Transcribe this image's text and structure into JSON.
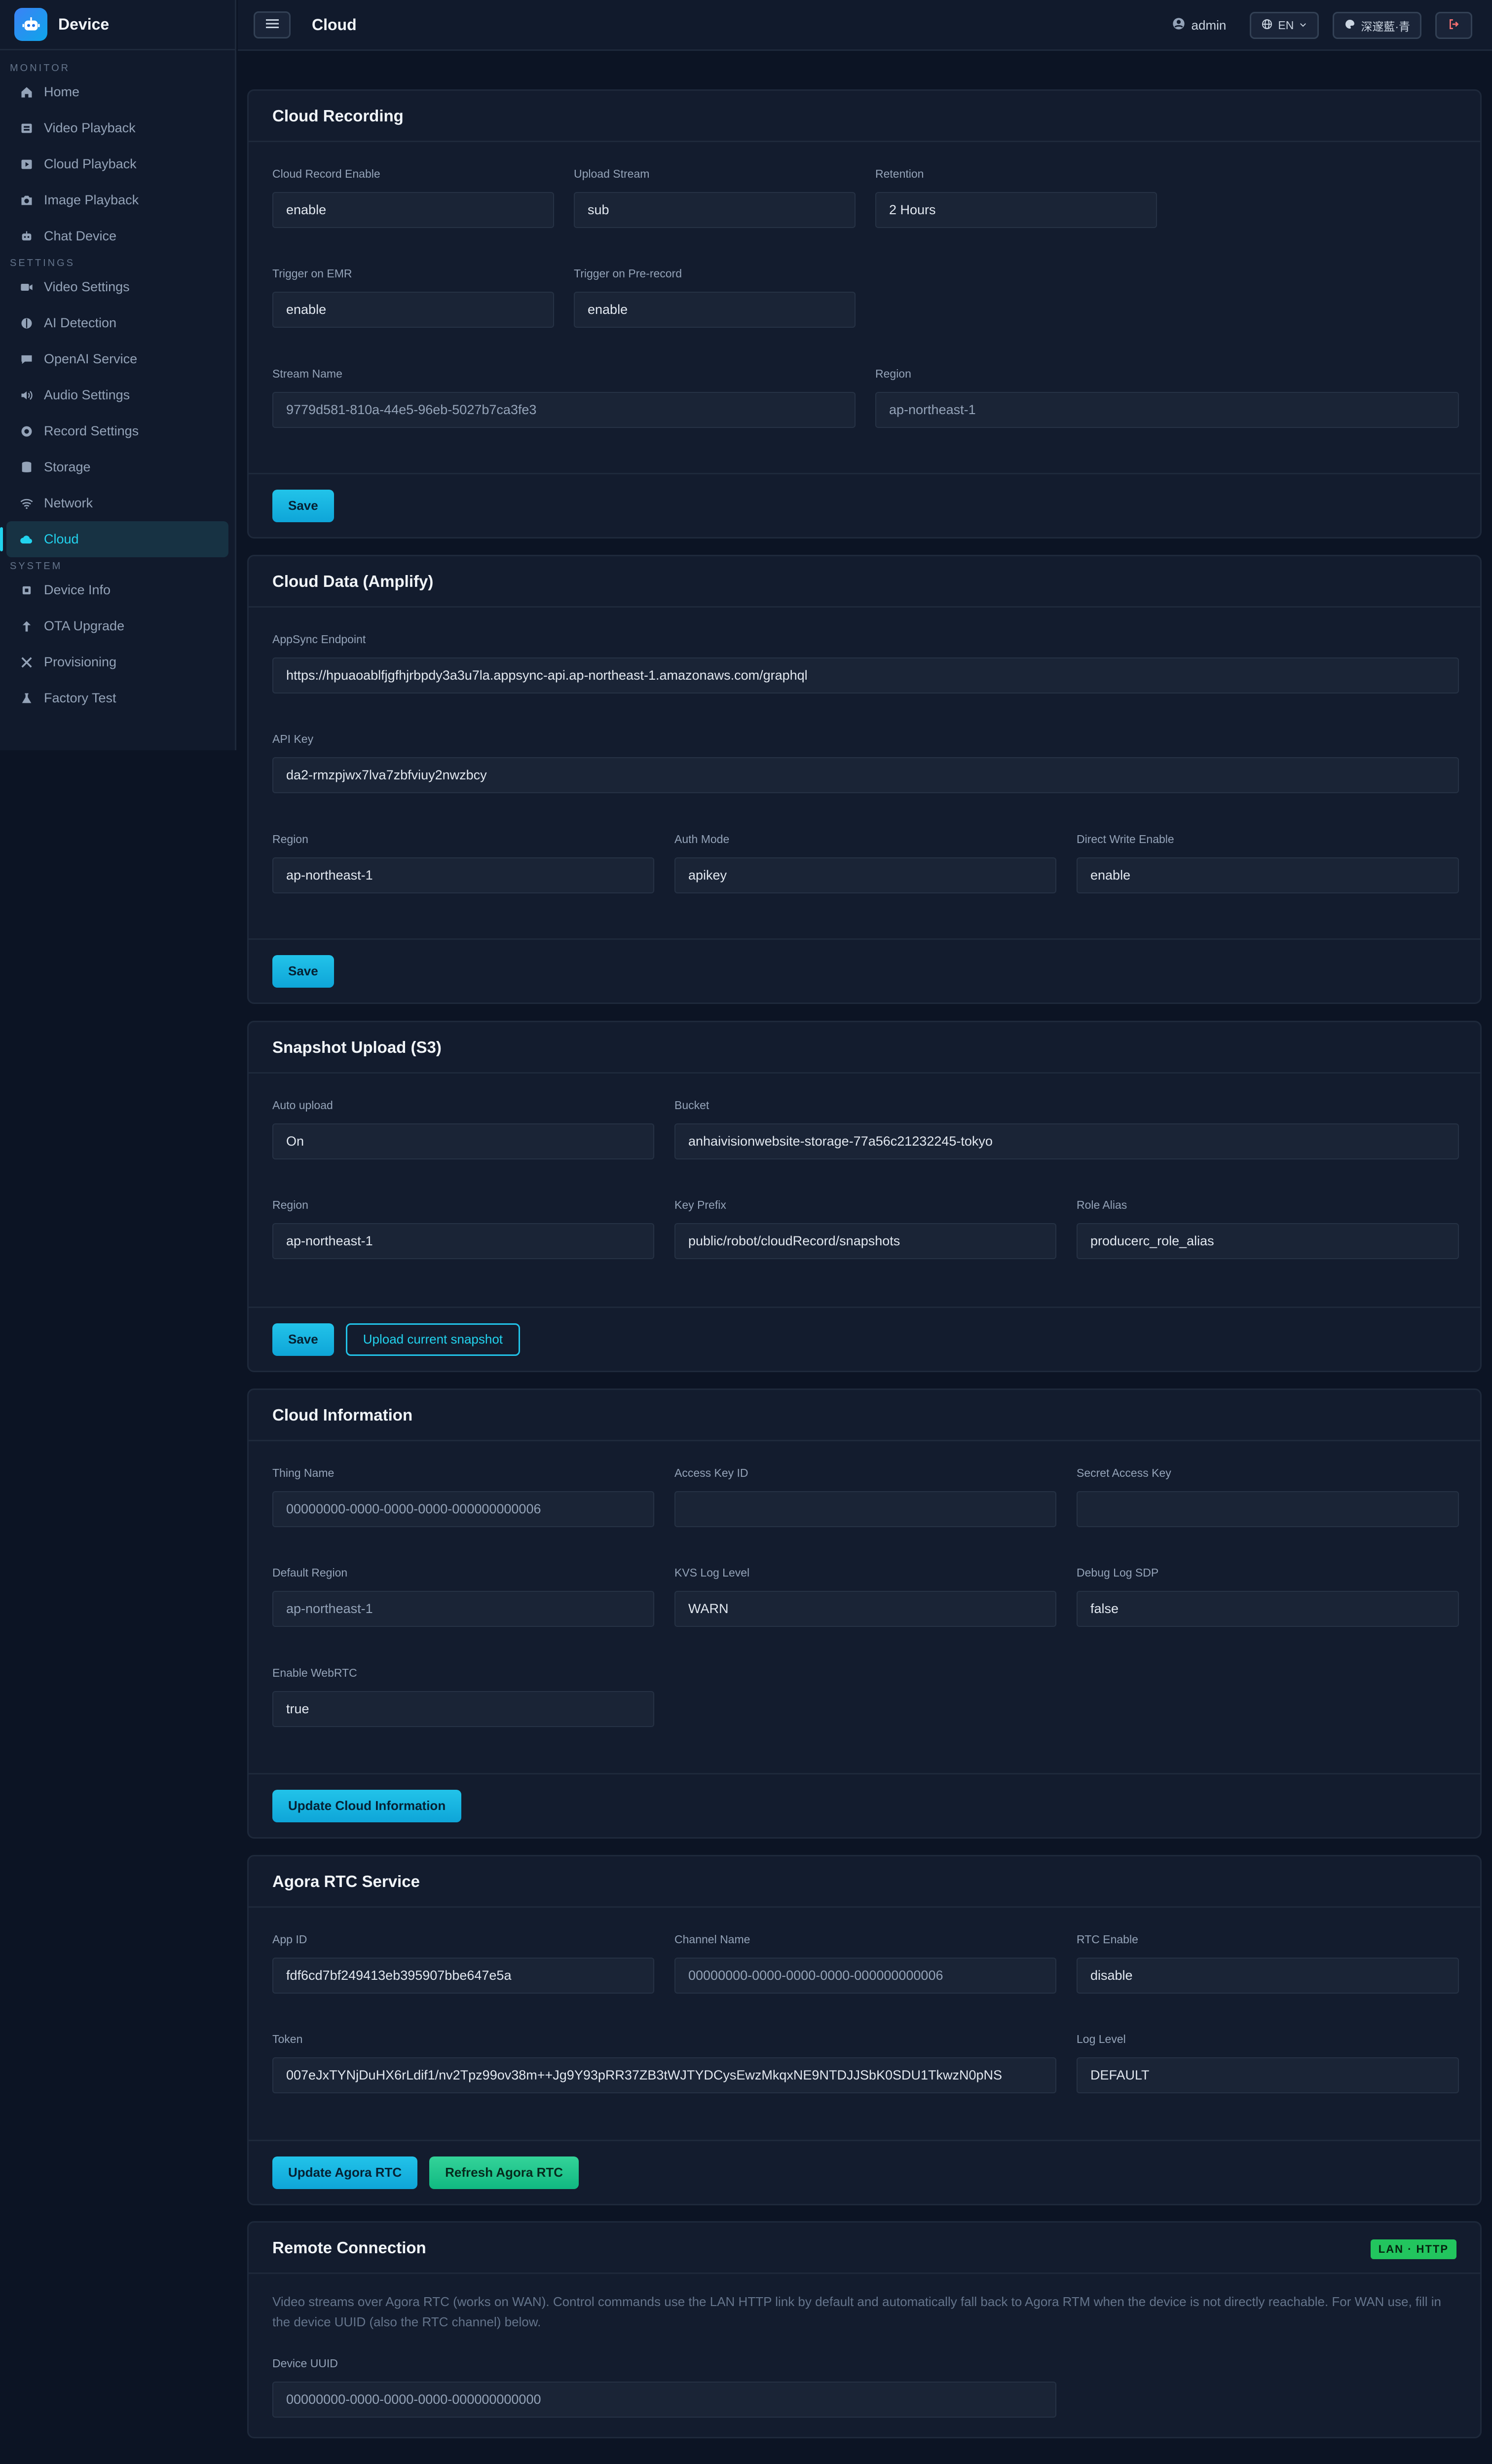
{
  "brand": {
    "title": "Device",
    "icon": "robot-icon"
  },
  "header": {
    "title": "Cloud",
    "user": "admin",
    "language": "EN",
    "theme": "深邃藍·青"
  },
  "sidebar": {
    "sections": {
      "monitor": "MONITOR",
      "settings": "SETTINGS",
      "system": "SYSTEM"
    },
    "items": {
      "home": "Home",
      "video_playback": "Video Playback",
      "cloud_playback": "Cloud Playback",
      "image_playback": "Image Playback",
      "chat_device": "Chat Device",
      "video_settings": "Video Settings",
      "ai_detection": "AI Detection",
      "openai_service": "OpenAI Service",
      "audio_settings": "Audio Settings",
      "record_settings": "Record Settings",
      "storage": "Storage",
      "network": "Network",
      "cloud": "Cloud",
      "device_info": "Device Info",
      "ota_upgrade": "OTA Upgrade",
      "provisioning": "Provisioning",
      "factory_test": "Factory Test"
    }
  },
  "cloud_recording": {
    "title": "Cloud Recording",
    "cloud_record_enable": {
      "label": "Cloud Record Enable",
      "value": "enable"
    },
    "upload_stream": {
      "label": "Upload Stream",
      "value": "sub"
    },
    "retention": {
      "label": "Retention",
      "value": "2 Hours"
    },
    "trigger_emr": {
      "label": "Trigger on EMR",
      "value": "enable"
    },
    "trigger_prerecord": {
      "label": "Trigger on Pre-record",
      "value": "enable"
    },
    "stream_name": {
      "label": "Stream Name",
      "value": "9779d581-810a-44e5-96eb-5027b7ca3fe3"
    },
    "region": {
      "label": "Region",
      "value": "ap-northeast-1"
    },
    "save": "Save"
  },
  "cloud_data": {
    "title": "Cloud Data (Amplify)",
    "endpoint": {
      "label": "AppSync Endpoint",
      "value": "https://hpuaoablfjgfhjrbpdy3a3u7la.appsync-api.ap-northeast-1.amazonaws.com/graphql"
    },
    "api_key": {
      "label": "API Key",
      "value": "da2-rmzpjwx7lva7zbfviuy2nwzbcy"
    },
    "region": {
      "label": "Region",
      "value": "ap-northeast-1"
    },
    "auth_mode": {
      "label": "Auth Mode",
      "value": "apikey"
    },
    "direct_write": {
      "label": "Direct Write Enable",
      "value": "enable"
    },
    "save": "Save"
  },
  "snapshot": {
    "title": "Snapshot Upload (S3)",
    "auto_upload": {
      "label": "Auto upload",
      "value": "On"
    },
    "bucket": {
      "label": "Bucket",
      "value": "anhaivisionwebsite-storage-77a56c21232245-tokyo"
    },
    "region": {
      "label": "Region",
      "value": "ap-northeast-1"
    },
    "key_prefix": {
      "label": "Key Prefix",
      "value": "public/robot/cloudRecord/snapshots"
    },
    "role_alias": {
      "label": "Role Alias",
      "value": "producerc_role_alias"
    },
    "save": "Save",
    "upload_current": "Upload current snapshot"
  },
  "cloud_info": {
    "title": "Cloud Information",
    "thing_name": {
      "label": "Thing Name",
      "value": "00000000-0000-0000-0000-000000000006"
    },
    "access_key": {
      "label": "Access Key ID",
      "value": ""
    },
    "secret_key": {
      "label": "Secret Access Key",
      "value": ""
    },
    "default_region": {
      "label": "Default Region",
      "value": "ap-northeast-1"
    },
    "kvs_log": {
      "label": "KVS Log Level",
      "value": "WARN"
    },
    "debug_sdp": {
      "label": "Debug Log SDP",
      "value": "false"
    },
    "webrtc": {
      "label": "Enable WebRTC",
      "value": "true"
    },
    "update": "Update Cloud Information"
  },
  "agora": {
    "title": "Agora RTC Service",
    "app_id": {
      "label": "App ID",
      "value": "fdf6cd7bf249413eb395907bbe647e5a"
    },
    "channel": {
      "label": "Channel Name",
      "value": "00000000-0000-0000-0000-000000000006"
    },
    "rtc_enable": {
      "label": "RTC Enable",
      "value": "disable"
    },
    "token": {
      "label": "Token",
      "value": "007eJxTYNjDuHX6rLdif1/nv2Tpz99ov38m++Jg9Y93pRR37ZB3tWJTYDCysEwzMkqxNE9NTDJJSbK0SDU1TkwzN0pNS"
    },
    "log_level": {
      "label": "Log Level",
      "value": "DEFAULT"
    },
    "update": "Update Agora RTC",
    "refresh": "Refresh Agora RTC"
  },
  "remote": {
    "title": "Remote Connection",
    "badge": "LAN · HTTP",
    "description": "Video streams over Agora RTC (works on WAN). Control commands use the LAN HTTP link by default and automatically fall back to Agora RTM when the device is not directly reachable. For WAN use, fill in the device UUID (also the RTC channel) below.",
    "device_uuid": {
      "label": "Device UUID",
      "value": "00000000-0000-0000-0000-000000000000"
    }
  },
  "colors": {
    "accent": "#22d3ee",
    "success": "#22c55e",
    "background": "#0c1424"
  }
}
